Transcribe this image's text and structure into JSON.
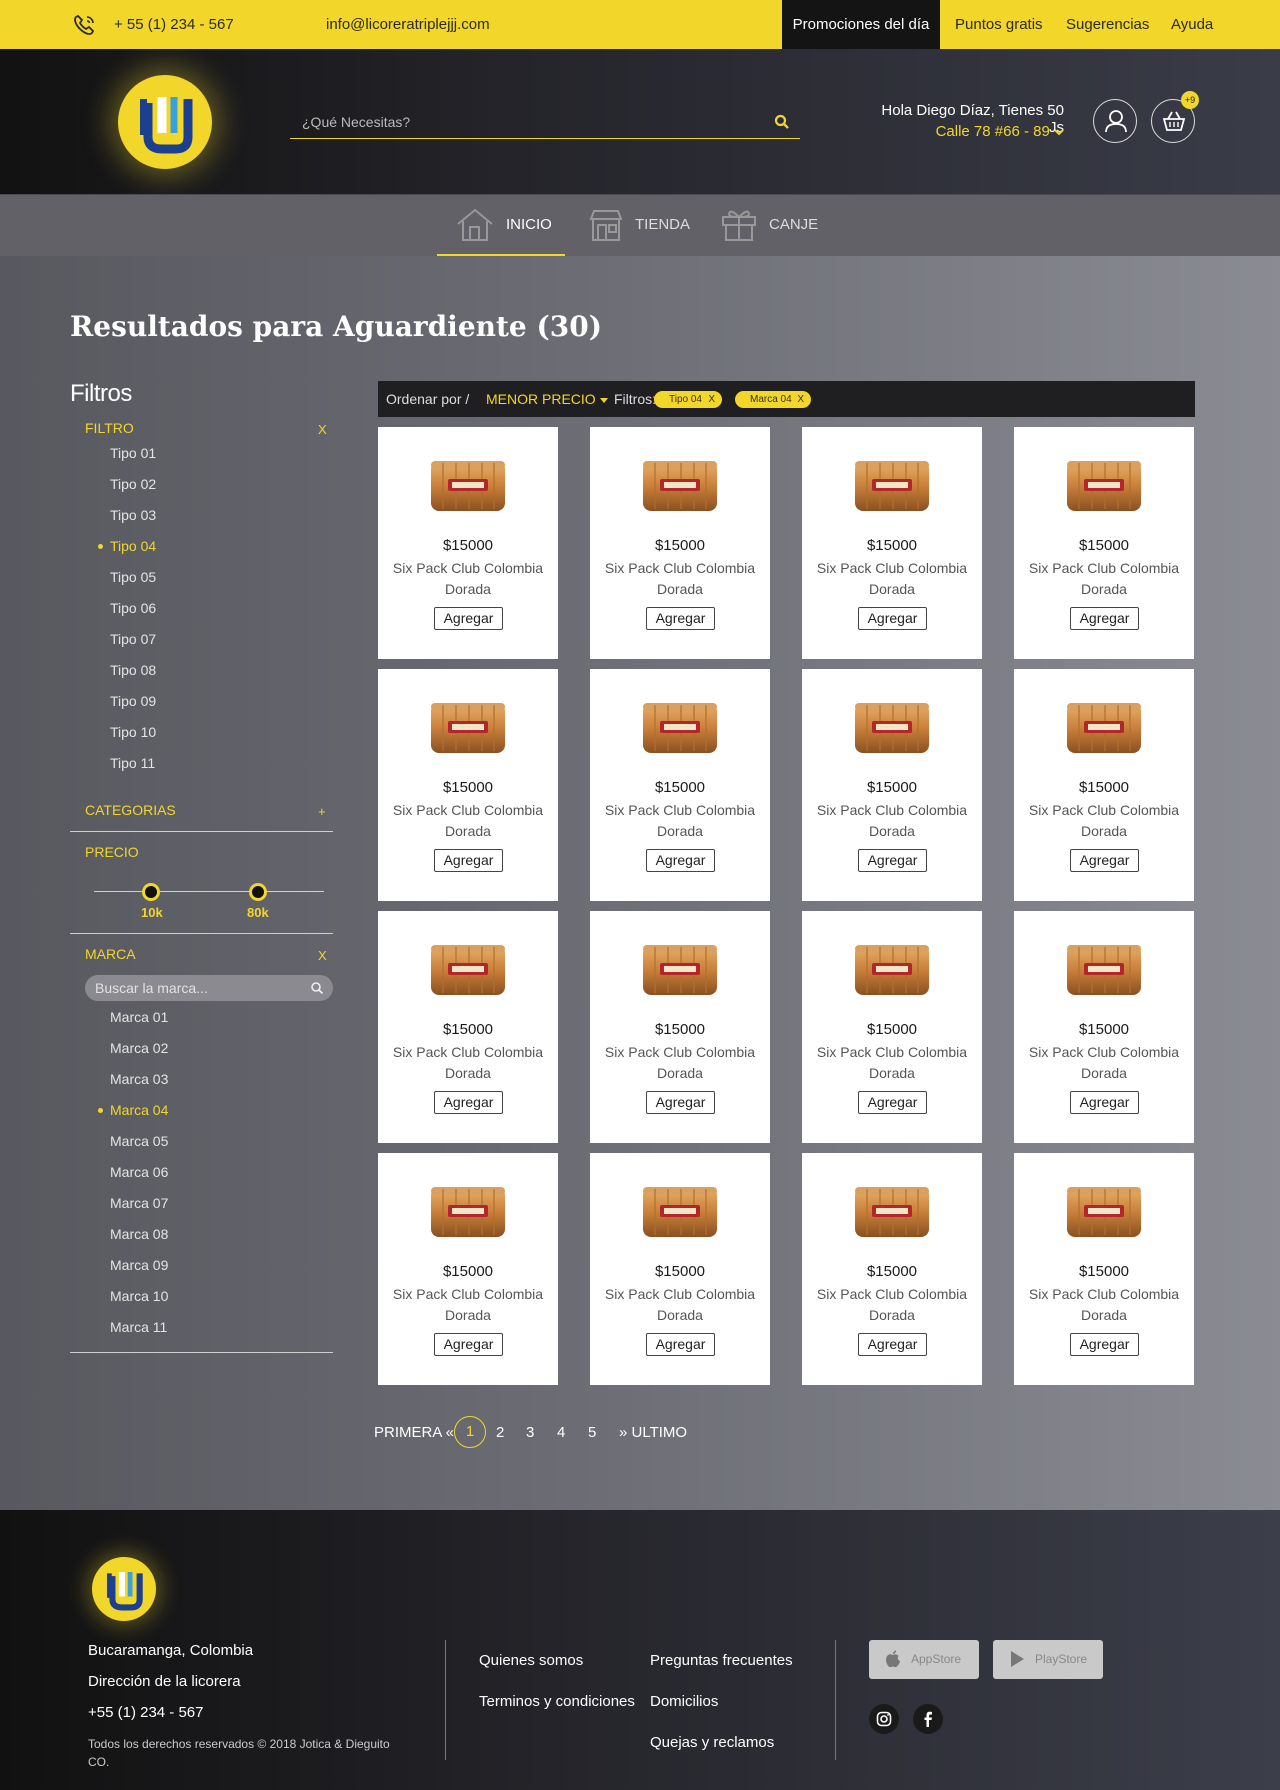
{
  "topbar": {
    "phone": "+ 55 (1) 234 - 567",
    "email": "info@licoreratriplejjj.com",
    "promo": "Promociones del día",
    "menu": [
      "Puntos gratis",
      "Sugerencias",
      "Ayuda"
    ]
  },
  "header": {
    "search_placeholder": "¿Qué Necesitas?",
    "greeting": "Hola Diego Díaz, Tienes 50 Js",
    "address": "Calle 78 #66 - 89",
    "cart_count": "+9"
  },
  "nav": [
    "INICIO",
    "TIENDA",
    "CANJE"
  ],
  "results_title": "Resultados para Aguardiente (30)",
  "sidebar": {
    "title": "Filtros",
    "filtro": {
      "label": "FILTRO",
      "toggle": "X",
      "options": [
        "Tipo 01",
        "Tipo 02",
        "Tipo 03",
        "Tipo 04",
        "Tipo 05",
        "Tipo 06",
        "Tipo 07",
        "Tipo 08",
        "Tipo 09",
        "Tipo 10",
        "Tipo 11"
      ],
      "selected": "Tipo 04"
    },
    "categorias": {
      "label": "CATEGORIAS",
      "toggle": "+"
    },
    "precio": {
      "label": "PRECIO",
      "min_label": "10k",
      "max_label": "80k"
    },
    "marca": {
      "label": "MARCA",
      "toggle": "X",
      "search_placeholder": "Buscar la marca...",
      "options": [
        "Marca 01",
        "Marca 02",
        "Marca 03",
        "Marca 04",
        "Marca 05",
        "Marca 06",
        "Marca 07",
        "Marca 08",
        "Marca 09",
        "Marca 10",
        "Marca 11"
      ],
      "selected": "Marca 04"
    }
  },
  "sortbar": {
    "label": "Ordenar por /",
    "value": "MENOR PRECIO",
    "filters_label": "Filtros:",
    "chips": [
      "Tipo 04",
      "Marca 04"
    ],
    "chip_remove": "X"
  },
  "product": {
    "price": "$15000",
    "name": "Six Pack Club Colombia Dorada",
    "button": "Agregar"
  },
  "pagination": {
    "first": "PRIMERA «",
    "pages": [
      "1",
      "2",
      "3",
      "4",
      "5"
    ],
    "current": "1",
    "last": "» ULTIMO"
  },
  "footer": {
    "city": "Bucaramanga, Colombia",
    "address": "Dirección de la licorera",
    "phone": "+55 (1) 234 - 567",
    "copyright": "Todos los derechos reservados © 2018 Jotica & Dieguito CO.",
    "links_col1": [
      "Quienes somos",
      "Terminos y condiciones"
    ],
    "links_col2": [
      "Preguntas frecuentes",
      "Domicilios",
      "Quejas y reclamos"
    ],
    "appstore": "AppStore",
    "playstore": "PlayStore"
  },
  "colors": {
    "accent": "#f2d62a",
    "dark": "#141414"
  }
}
